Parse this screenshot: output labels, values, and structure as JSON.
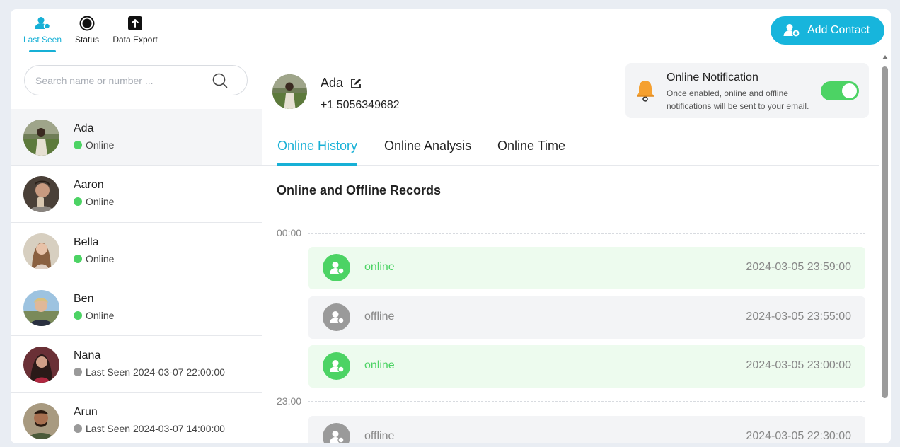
{
  "nav": {
    "tabs": [
      {
        "label": "Last Seen",
        "icon": "user-group-icon",
        "active": true
      },
      {
        "label": "Status",
        "icon": "status-circle-icon",
        "active": false
      },
      {
        "label": "Data Export",
        "icon": "export-upload-icon",
        "active": false
      }
    ],
    "add_contact_label": "Add Contact"
  },
  "search": {
    "placeholder": "Search name or number ..."
  },
  "contacts": [
    {
      "name": "Ada",
      "status": "Online",
      "state": "online",
      "selected": true
    },
    {
      "name": "Aaron",
      "status": "Online",
      "state": "online",
      "selected": false
    },
    {
      "name": "Bella",
      "status": "Online",
      "state": "online",
      "selected": false
    },
    {
      "name": "Ben",
      "status": "Online",
      "state": "online",
      "selected": false
    },
    {
      "name": "Nana",
      "status": "Last Seen 2024-03-07 22:00:00",
      "state": "offline",
      "selected": false
    },
    {
      "name": "Arun",
      "status": "Last Seen 2024-03-07 14:00:00",
      "state": "offline",
      "selected": false
    }
  ],
  "profile": {
    "name": "Ada",
    "phone": "+1 5056349682"
  },
  "notification": {
    "title": "Online Notification",
    "description": "Once enabled, online and offline notifications will be sent to your email.",
    "enabled": true
  },
  "tabs": [
    {
      "label": "Online History",
      "active": true
    },
    {
      "label": "Online Analysis",
      "active": false
    },
    {
      "label": "Online Time",
      "active": false
    }
  ],
  "section_title": "Online and Offline Records",
  "time_markers": [
    "00:00",
    "23:00"
  ],
  "records": [
    {
      "state": "online",
      "time": "2024-03-05 23:59:00"
    },
    {
      "state": "offline",
      "time": "2024-03-05 23:55:00"
    },
    {
      "state": "online",
      "time": "2024-03-05 23:00:00"
    },
    {
      "state": "offline",
      "time": "2024-03-05 22:30:00"
    }
  ],
  "colors": {
    "accent": "#17b0d6",
    "online": "#4cd364",
    "offline": "#9a9a9a",
    "bell": "#f5a030"
  }
}
